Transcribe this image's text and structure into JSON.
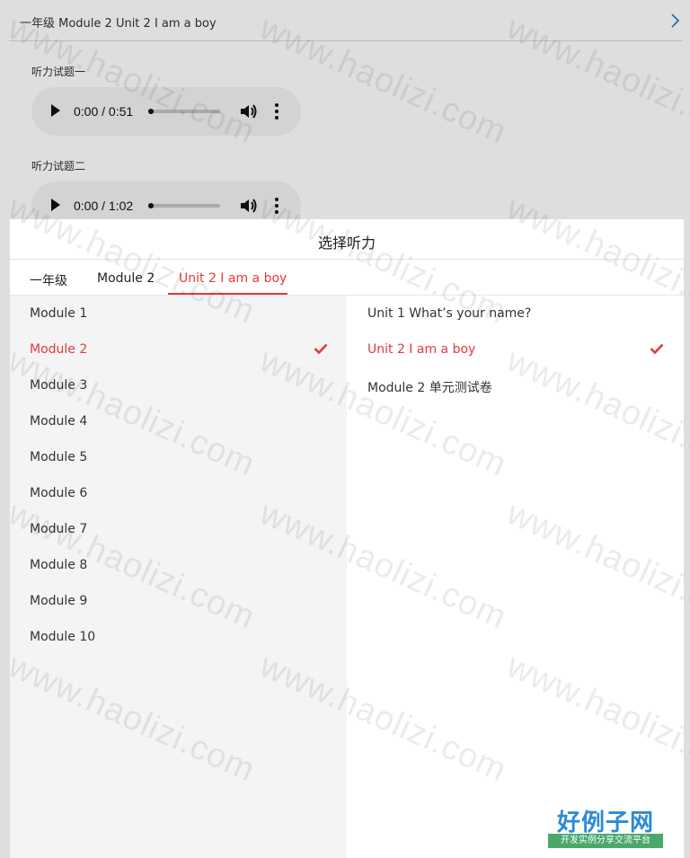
{
  "header": {
    "title": "一年级 Module 2 Unit 2 I am a boy"
  },
  "sections": [
    {
      "label": "听力试题一",
      "time": "0:00 / 0:51"
    },
    {
      "label": "听力试题二",
      "time": "0:00 / 1:02"
    }
  ],
  "dialog": {
    "title": "选择听力",
    "tabs": [
      "一年级",
      "Module 2",
      "Unit 2 I am a boy"
    ],
    "active_tab": 2,
    "modules": [
      "Module 1",
      "Module 2",
      "Module 3",
      "Module 4",
      "Module 5",
      "Module 6",
      "Module 7",
      "Module 8",
      "Module 9",
      "Module 10"
    ],
    "selected_module": 1,
    "units": [
      "Unit 1 What’s your name?",
      "Unit 2 I am a boy",
      "Module 2 单元测试卷"
    ],
    "selected_unit": 1
  },
  "watermark": "www.haolizi.com",
  "logo": {
    "title": "好例子网",
    "subtitle": "开发实例分享交流平台"
  },
  "colors": {
    "accent": "#e4393c",
    "logo_blue": "#2a8bd8",
    "logo_green": "#4aa86a"
  },
  "icons": [
    "chevron-right-icon",
    "play-icon",
    "volume-icon",
    "more-vert-icon",
    "check-icon"
  ]
}
